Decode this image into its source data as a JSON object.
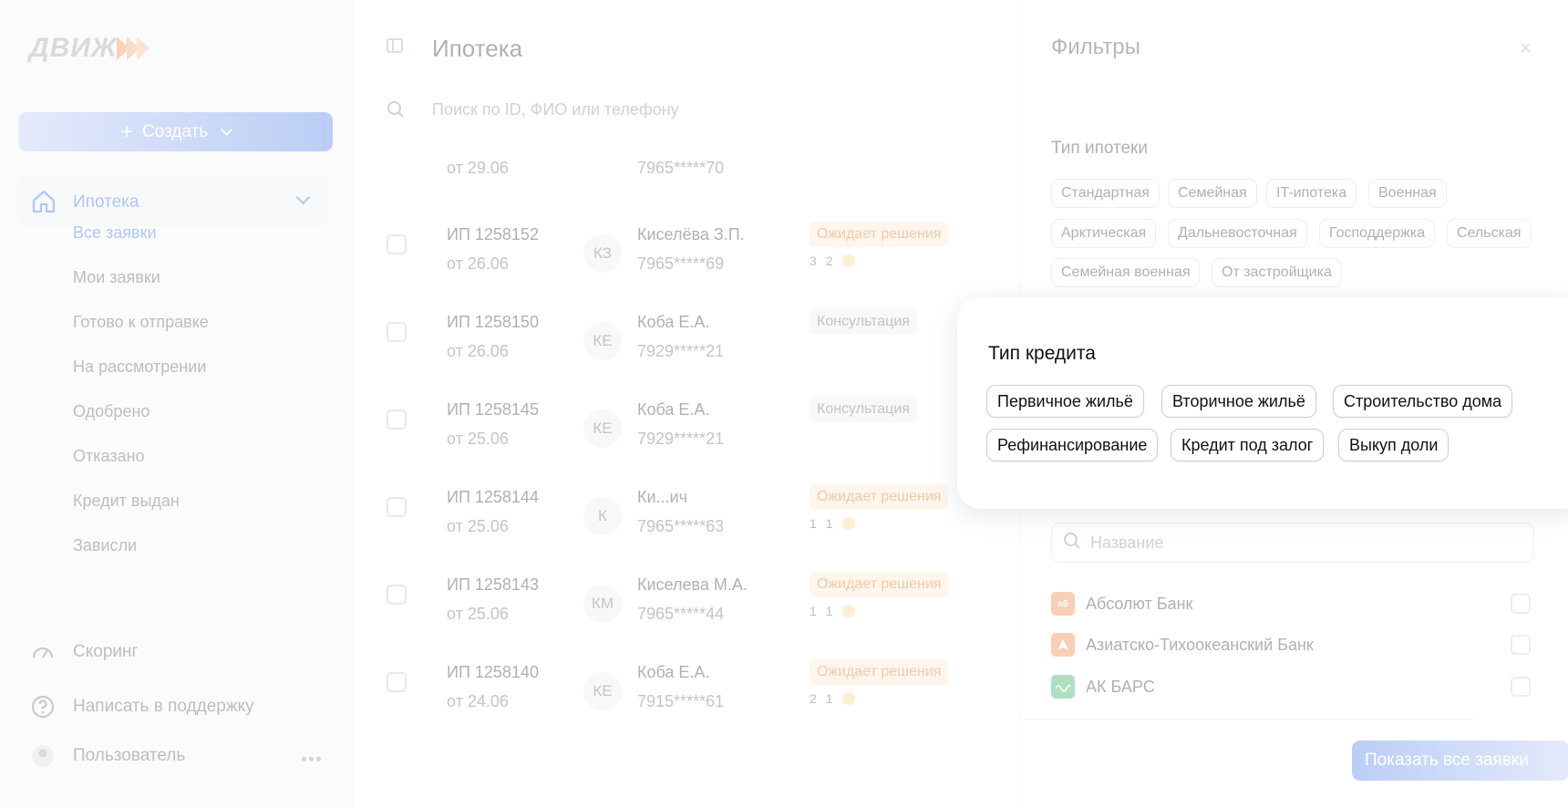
{
  "logo": {
    "text": "ДВИЖ"
  },
  "sidebar": {
    "create_label": "Создать",
    "main_item": "Ипотека",
    "sub_items": [
      "Все заявки",
      "Мои заявки",
      "Готово к отправке",
      "На рассмотрении",
      "Одобрено",
      "Отказано",
      "Кредит выдан",
      "Зависли"
    ],
    "bottom_items": [
      "Скоринг",
      "Написать в поддержку",
      "Пользователь"
    ],
    "dots": "•••"
  },
  "main": {
    "title": "Ипотека",
    "search_placeholder": "Поиск по ID, ФИО или телефону",
    "rows": [
      {
        "id": "",
        "date": "от 29.06",
        "initials": "",
        "name": "",
        "phone": "7965*****70",
        "status": "",
        "counts": [
          "",
          ""
        ]
      },
      {
        "id": "ИП 1258152",
        "date": "от 26.06",
        "initials": "КЗ",
        "name": "Киселёва З.П.",
        "phone": "7965*****69",
        "status": "Ожидает решения",
        "counts": [
          "3",
          "2"
        ]
      },
      {
        "id": "ИП 1258150",
        "date": "от 26.06",
        "initials": "КЕ",
        "name": "Коба Е.А.",
        "phone": "7929*****21",
        "status": "Консультация",
        "counts": [
          "",
          ""
        ]
      },
      {
        "id": "ИП 1258145",
        "date": "от 25.06",
        "initials": "КЕ",
        "name": "Коба Е.А.",
        "phone": "7929*****21",
        "status": "Консультация",
        "counts": [
          "",
          ""
        ]
      },
      {
        "id": "ИП 1258144",
        "date": "от 25.06",
        "initials": "К",
        "name": "Ки...ич",
        "phone": "7965*****63",
        "status": "Ожидает решения",
        "counts": [
          "1",
          "1"
        ]
      },
      {
        "id": "ИП 1258143",
        "date": "от 25.06",
        "initials": "КМ",
        "name": "Киселева М.А.",
        "phone": "7965*****44",
        "status": "Ожидает решения",
        "counts": [
          "1",
          "1"
        ]
      },
      {
        "id": "ИП 1258140",
        "date": "от 24.06",
        "initials": "КЕ",
        "name": "Коба Е.А.",
        "phone": "7915*****61",
        "status": "Ожидает решения",
        "counts": [
          "2",
          "1"
        ]
      }
    ]
  },
  "filters": {
    "title": "Фильтры",
    "close": "×",
    "mortgage_type_title": "Тип ипотеки",
    "mortgage_types": [
      "Стандартная",
      "Семейная",
      "IT-ипотека",
      "Военная",
      "Арктическая",
      "Дальневосточная",
      "Господдержка",
      "Сельская",
      "Семейная военная",
      "От застройщика"
    ],
    "bank_search_placeholder": "Название",
    "banks": [
      {
        "name": "Абсолют Банк",
        "logo": "аб",
        "color": "#f0823e"
      },
      {
        "name": "Азиатско-Тихоокеанский Банк",
        "logo": "",
        "color": "#f0823e"
      },
      {
        "name": "АК БАРС",
        "logo": "",
        "color": "#2fae5e"
      }
    ],
    "show_button": "Показать все заявки"
  },
  "popup": {
    "title": "Тип кредита",
    "options": [
      "Первичное жильё",
      "Вторичное жильё",
      "Строительство дома",
      "Рефинансирование",
      "Кредит под залог",
      "Выкуп доли"
    ]
  },
  "colors": {
    "accent": "#2f6de0",
    "orange": "#f28a4b",
    "status_wait_bg": "#fde9cf",
    "status_wait_text": "#e0741c"
  }
}
